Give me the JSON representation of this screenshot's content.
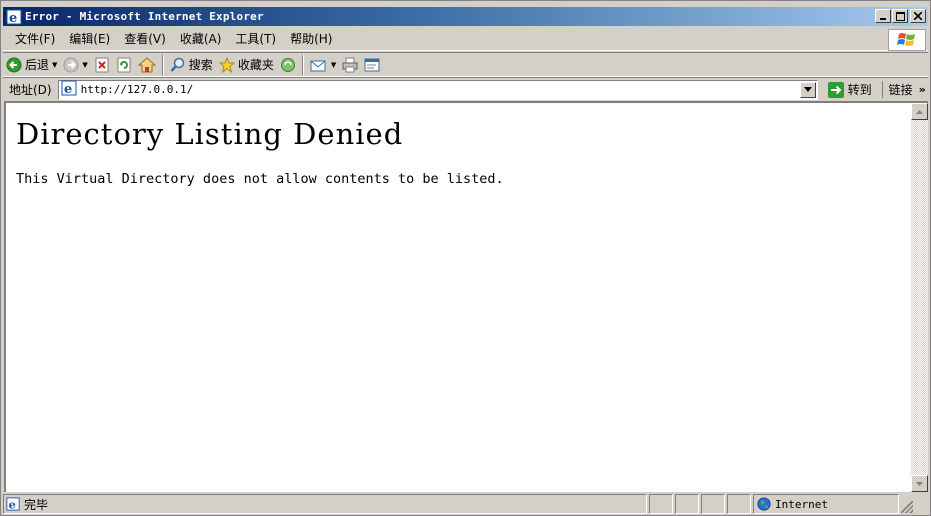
{
  "window": {
    "title": "Error - Microsoft Internet Explorer"
  },
  "menu": {
    "items": [
      {
        "label": "文件(F)"
      },
      {
        "label": "编辑(E)"
      },
      {
        "label": "查看(V)"
      },
      {
        "label": "收藏(A)"
      },
      {
        "label": "工具(T)"
      },
      {
        "label": "帮助(H)"
      }
    ]
  },
  "toolbar": {
    "back_label": "后退",
    "search_label": "搜索",
    "favorites_label": "收藏夹"
  },
  "address": {
    "label": "地址(D)",
    "value": "http://127.0.0.1/",
    "go_label": "转到",
    "links_label": "链接",
    "links_more": "»"
  },
  "page": {
    "heading": "Directory Listing Denied",
    "message": "This Virtual Directory does not allow contents to be listed."
  },
  "status": {
    "text": "完毕",
    "zone": "Internet"
  },
  "colors": {
    "title_gradient_start": "#0a246a",
    "title_gradient_end": "#a6caf0",
    "chrome": "#d4d0c8"
  }
}
